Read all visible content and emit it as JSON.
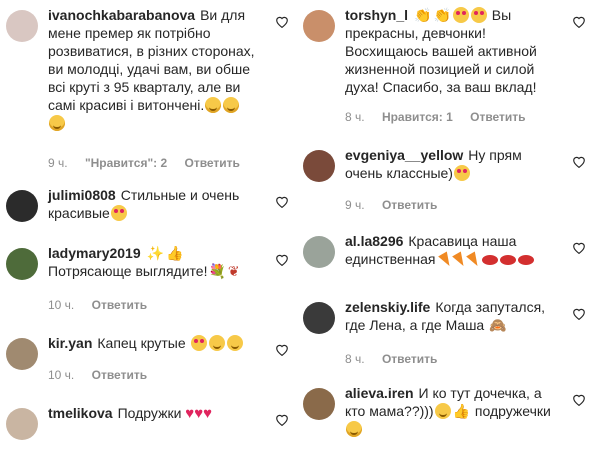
{
  "labels": {
    "reply": "Ответить"
  },
  "left": [
    {
      "username": "ivanochkabarabanova",
      "text": "Ви для мене премер як потрібно розвиватися, в різних сторонах, ви молодці, удачі вам, ви обше всі круті з 95 кварталу, але ви самі красиві і витончені.",
      "time": "9 ч.",
      "likes": "\"Нравится\": 2",
      "avatar_color": "#d9c7c2"
    },
    {
      "username": "julimi0808",
      "text": "Стильные и очень красивые",
      "time": "",
      "likes": "",
      "avatar_color": "#2b2b2b"
    },
    {
      "username": "ladymary2019",
      "text": "Потрясающе выглядите!",
      "time": "10 ч.",
      "likes": "",
      "avatar_color": "#4e6b3a"
    },
    {
      "username": "kir.yan",
      "text": "Капец крутые",
      "time": "10 ч.",
      "likes": "",
      "avatar_color": "#a08a70"
    },
    {
      "username": "tmelikova",
      "text": "Подружки",
      "time": "",
      "likes": "",
      "avatar_color": "#c9b5a2"
    }
  ],
  "right": [
    {
      "username": "torshyn_l",
      "text": "Вы прекрасны, девчонки! Восхищаюсь вашей активной жизненной позицией и силой духа! Спасибо, за ваш вклад!",
      "time": "8 ч.",
      "likes": "Нравится: 1",
      "avatar_color": "#c98f6a"
    },
    {
      "username": "evgeniya__yellow",
      "text": "Ну прям очень классные)",
      "time": "9 ч.",
      "likes": "",
      "avatar_color": "#7a4a3a"
    },
    {
      "username": "al.la8296",
      "text": "Красавица наша единственная",
      "time": "",
      "likes": "",
      "avatar_color": "#9aa39a"
    },
    {
      "username": "zelenskiy.life",
      "text": "Когда запутался, где Лена, а где Маша",
      "time": "8 ч.",
      "likes": "",
      "avatar_color": "#3a3a3a"
    },
    {
      "username": "alieva.iren",
      "text": "И ко тут дочечка, а кто мама??)))",
      "text_tail": "подружечки",
      "time": "",
      "likes": "",
      "avatar_color": "#8a6a4a"
    }
  ],
  "icons": [
    "heart-outline-icon"
  ]
}
